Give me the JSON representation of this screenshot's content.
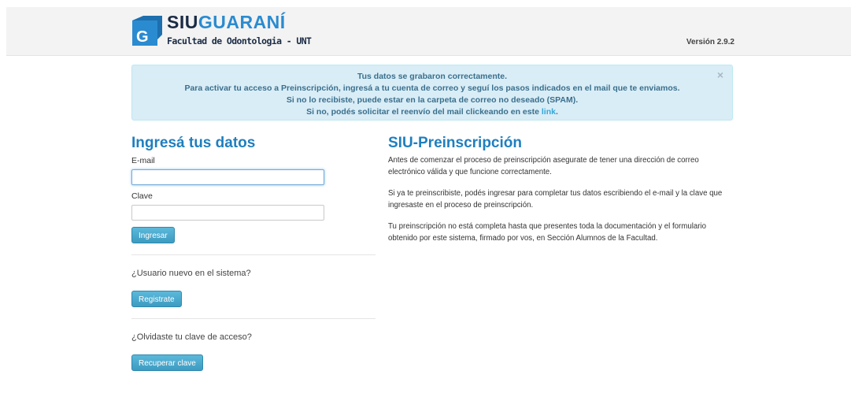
{
  "header": {
    "logo": {
      "brand_siu": "SIU",
      "brand_guarani": "GUARANÍ",
      "subtitle": "Facultad de Odontologia - UNT"
    },
    "version": "Versión 2.9.2"
  },
  "alert": {
    "line1": "Tus datos se grabaron correctamente.",
    "line2": "Para activar tu acceso a Preinscripción, ingresá a tu cuenta de correo y seguí los pasos indicados en el mail que te enviamos.",
    "line3": "Si no lo recibiste, puede estar en la carpeta de correo no deseado (SPAM).",
    "line4_prefix": "Si no, podés solicitar el reenvío del mail clickeando en este ",
    "line4_link": "link",
    "line4_suffix": ".",
    "close": "×"
  },
  "login": {
    "title": "Ingresá tus datos",
    "email_label": "E-mail",
    "email_value": "",
    "password_label": "Clave",
    "password_value": "",
    "submit": "Ingresar"
  },
  "register": {
    "question": "¿Usuario nuevo en el sistema?",
    "button": "Registrate"
  },
  "recover": {
    "question": "¿Olvidaste tu clave de acceso?",
    "button": "Recuperar clave"
  },
  "info": {
    "title": "SIU-Preinscripción",
    "paragraphs": [
      "Antes de comenzar el proceso de preinscripción asegurate de tener una dirección de correo electrónico válida y que funcione correctamente.",
      "Si ya te preinscribiste, podés ingresar para completar tus datos escribiendo el e-mail y la clave que ingresaste en el proceso de preinscripción.",
      "Tu preinscripción no está completa hasta que presentes toda la documentación y el formulario obtenido por este sistema, firmado por vos, en Sección Alumnos de la Facultad."
    ]
  },
  "colors": {
    "accent": "#1f7fbf",
    "button": "#45a5c9",
    "alert_bg": "#d9edf7",
    "logo_blue": "#2a8bd0"
  }
}
